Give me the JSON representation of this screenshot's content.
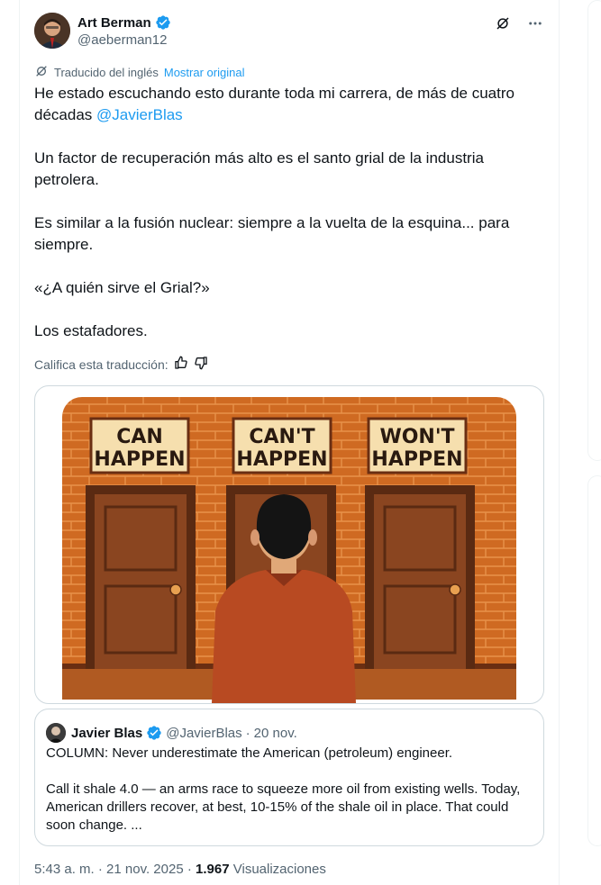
{
  "author": {
    "name": "Art Berman",
    "handle": "@aeberman12"
  },
  "translation": {
    "label": "Traducido del inglés",
    "show_original": "Mostrar original"
  },
  "tweet": {
    "line1_a": "He estado escuchando esto durante toda mi carrera, de más de cuatro décadas ",
    "mention": "@JavierBlas",
    "p2": "Un factor de recuperación más alto es el santo grial de la industria petrolera.",
    "p3": "Es similar a la fusión nuclear: siempre a la vuelta de la esquina... para siempre.",
    "p4": "«¿A quién sirve el Grial?»",
    "p5": "Los estafadores."
  },
  "rate_translation": "Califica esta traducción:",
  "image": {
    "signs": [
      "CAN\nHAPPEN",
      "CAN'T\nHAPPEN",
      "WON'T\nHAPPEN"
    ]
  },
  "quoted": {
    "name": "Javier Blas",
    "handle": "@JavierBlas",
    "dot": "·",
    "date": "20 nov.",
    "p1": "COLUMN: Never underestimate the American (petroleum) engineer.",
    "p2": "Call it shale 4.0 — an arms race to squeeze more oil from existing wells. Today, American drillers recover, at best, 10-15% of the shale oil in place. That could soon change. ..."
  },
  "meta": {
    "time": "5:43 a. m.",
    "sep1": "·",
    "date": "21 nov. 2025",
    "sep2": "·",
    "views": "1.967",
    "views_label": "Visualizaciones"
  },
  "colors": {
    "accent": "#1d9bf0",
    "brick": "#c9651f",
    "door": "#7a3a1a",
    "sign_bg": "#f6dfae"
  },
  "icons": [
    "verified-badge-icon",
    "grok-icon",
    "more-icon",
    "translate-icon",
    "thumbs-up-icon",
    "thumbs-down-icon"
  ]
}
